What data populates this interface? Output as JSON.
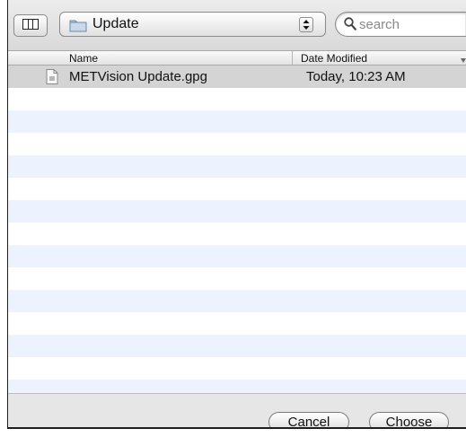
{
  "toolbar": {
    "view_icon": "column-view-icon",
    "path_popup": {
      "label": "Update",
      "icon": "folder-icon",
      "stepper_icon": "up-down-arrows-icon"
    },
    "search": {
      "placeholder": "search",
      "icon": "magnifier-icon"
    }
  },
  "file_list": {
    "columns": [
      "Name",
      "Date Modified"
    ],
    "sort_icon": "sort-arrow-icon",
    "files": [
      {
        "name": "METVision Update.gpg",
        "date_modified": "Today, 10:23 AM",
        "icon": "document-icon"
      }
    ]
  },
  "buttons": {
    "cancel": "Cancel",
    "choose": "Choose"
  },
  "colors": {
    "stripe": "#edf3fe",
    "selected_row": "#d4d4d4",
    "chrome": "#e6e6e6"
  }
}
